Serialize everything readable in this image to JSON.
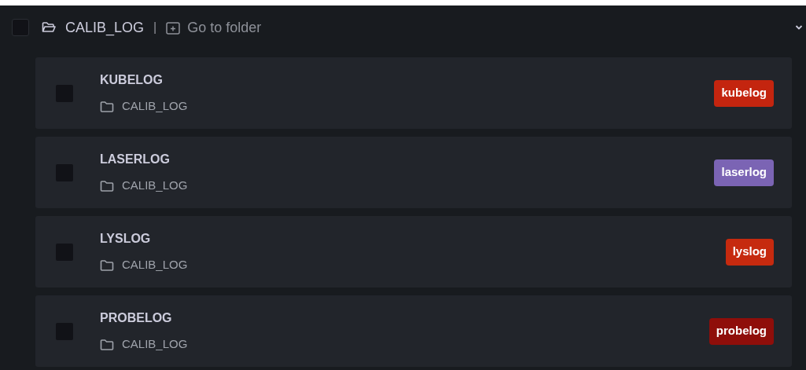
{
  "folder": {
    "name": "CALIB_LOG",
    "separator": "|",
    "link": "Go to folder",
    "expanded": true,
    "checked": false
  },
  "items": [
    {
      "title": "KUBELOG",
      "location": "CALIB_LOG",
      "tag": "kubelog",
      "color": "#c4250f",
      "checked": false
    },
    {
      "title": "LASERLOG",
      "location": "CALIB_LOG",
      "tag": "laserlog",
      "color": "#7b64b4",
      "checked": false
    },
    {
      "title": "LYSLOG",
      "location": "CALIB_LOG",
      "tag": "lyslog",
      "color": "#c62a0f",
      "checked": false
    },
    {
      "title": "PROBELOG",
      "location": "CALIB_LOG",
      "tag": "probelog",
      "color": "#8f0e0a",
      "checked": false
    }
  ]
}
